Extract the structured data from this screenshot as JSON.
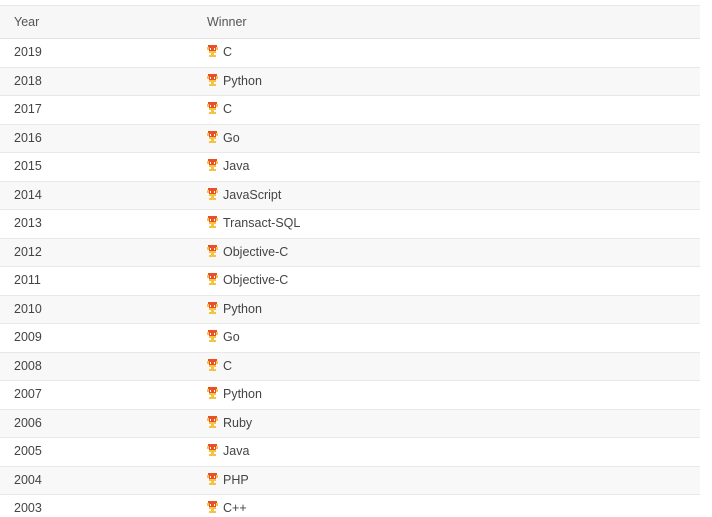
{
  "table": {
    "columns": [
      {
        "key": "year",
        "label": "Year"
      },
      {
        "key": "winner",
        "label": "Winner"
      }
    ],
    "winner_icon": "trophy-icon",
    "colors": {
      "header_background": "#f7f7f7",
      "header_text": "#555555",
      "row_text": "#444444",
      "row_odd_background": "#ffffff",
      "row_even_background": "#f8f8f8",
      "border": "#e8e8e8",
      "icon_primary": "#e8502a",
      "icon_secondary": "#f5c242"
    },
    "rows": [
      {
        "year": "2019",
        "winner": "C"
      },
      {
        "year": "2018",
        "winner": "Python"
      },
      {
        "year": "2017",
        "winner": "C"
      },
      {
        "year": "2016",
        "winner": "Go"
      },
      {
        "year": "2015",
        "winner": "Java"
      },
      {
        "year": "2014",
        "winner": "JavaScript"
      },
      {
        "year": "2013",
        "winner": "Transact-SQL"
      },
      {
        "year": "2012",
        "winner": "Objective-C"
      },
      {
        "year": "2011",
        "winner": "Objective-C"
      },
      {
        "year": "2010",
        "winner": "Python"
      },
      {
        "year": "2009",
        "winner": "Go"
      },
      {
        "year": "2008",
        "winner": "C"
      },
      {
        "year": "2007",
        "winner": "Python"
      },
      {
        "year": "2006",
        "winner": "Ruby"
      },
      {
        "year": "2005",
        "winner": "Java"
      },
      {
        "year": "2004",
        "winner": "PHP"
      },
      {
        "year": "2003",
        "winner": "C++"
      }
    ]
  }
}
